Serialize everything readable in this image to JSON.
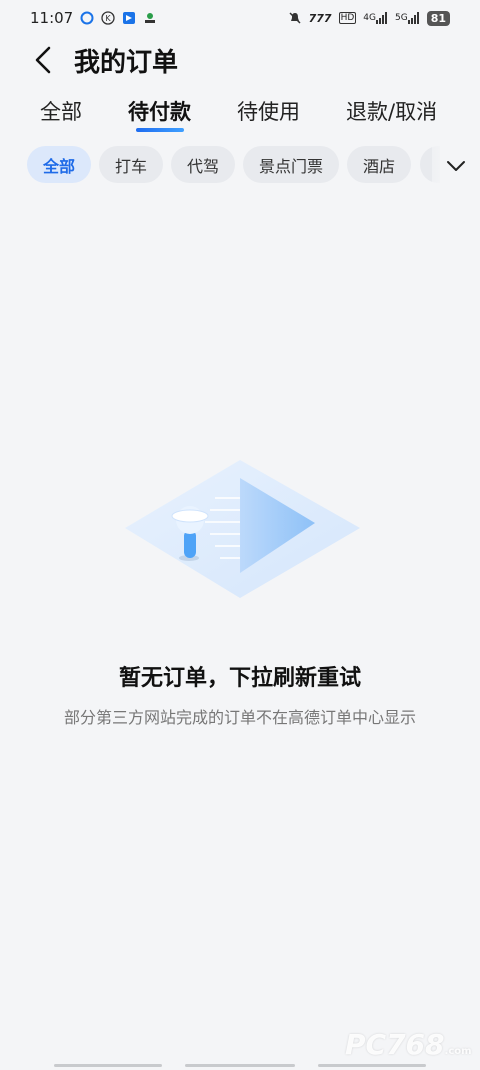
{
  "status_bar": {
    "time": "11:07",
    "battery": "81",
    "icons": [
      "app-circle-icon",
      "k-circle-icon",
      "app-square-icon",
      "cloud-app-icon",
      "mute-icon",
      "speed-icon",
      "hd-icon",
      "signal-4g-icon",
      "signal-5g-icon"
    ],
    "net1": "4G",
    "net2": "5G",
    "hd": "HD"
  },
  "header": {
    "title": "我的订单"
  },
  "tabs": [
    {
      "label": "全部",
      "active": false
    },
    {
      "label": "待付款",
      "active": true
    },
    {
      "label": "待使用",
      "active": false
    },
    {
      "label": "退款/取消",
      "active": false
    }
  ],
  "chips": [
    {
      "label": "全部",
      "active": true
    },
    {
      "label": "打车",
      "active": false
    },
    {
      "label": "代驾",
      "active": false
    },
    {
      "label": "景点门票",
      "active": false
    },
    {
      "label": "酒店",
      "active": false
    }
  ],
  "empty": {
    "title": "暂无订单，下拉刷新重试",
    "desc": "部分第三方网站完成的订单不在高德订单中心显示"
  },
  "watermark": {
    "text": "PC768",
    "sub": ".com"
  },
  "colors": {
    "accent": "#1f6be8",
    "background": "#f4f5f7"
  }
}
